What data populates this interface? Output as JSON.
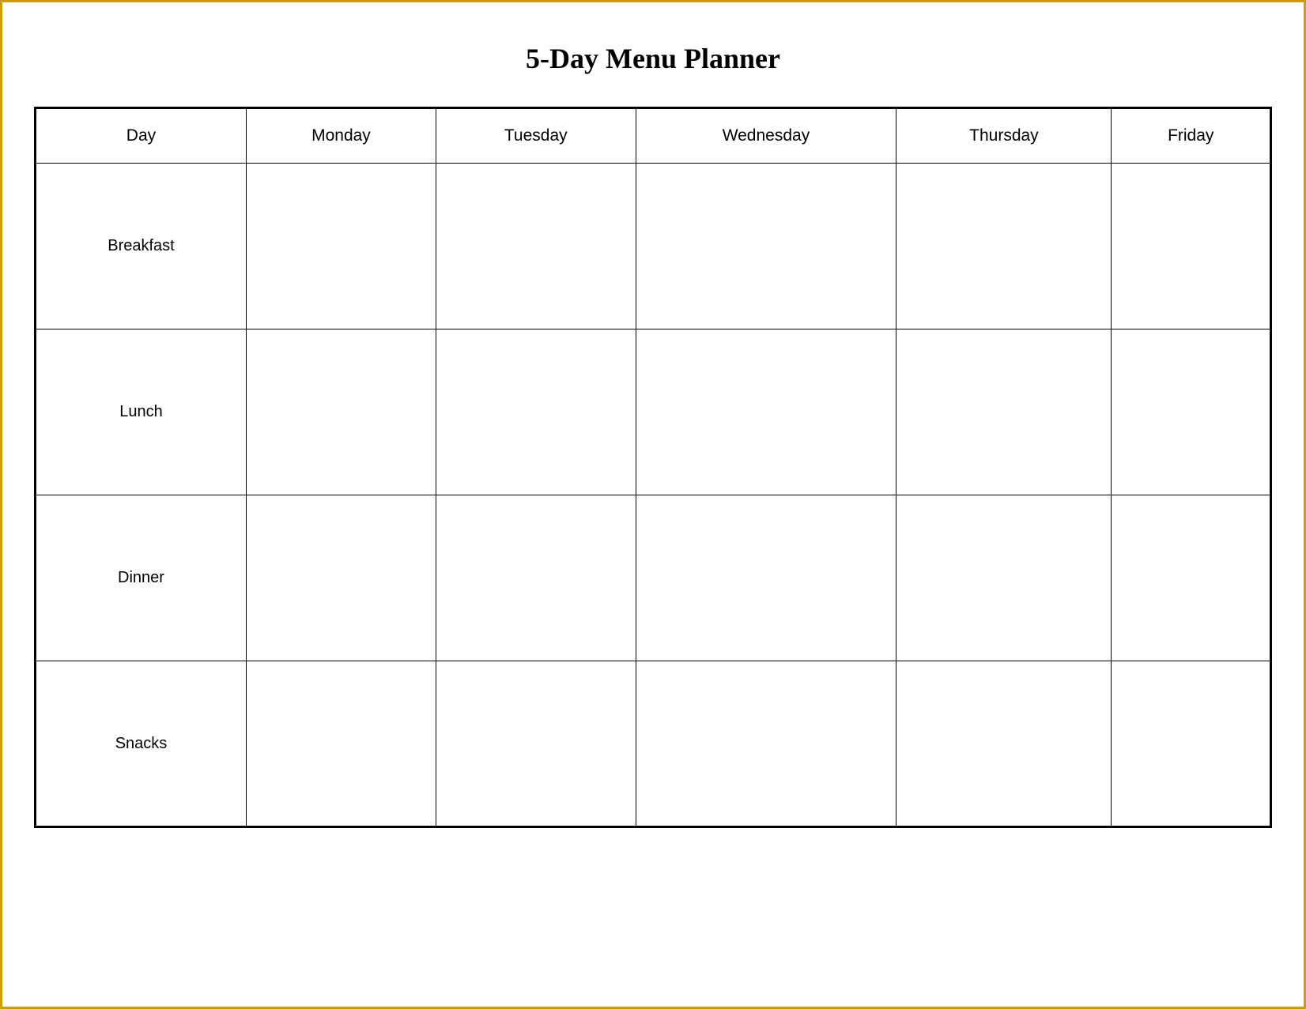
{
  "title": "5-Day Menu Planner",
  "columns": {
    "day": "Day",
    "monday": "Monday",
    "tuesday": "Tuesday",
    "wednesday": "Wednesday",
    "thursday": "Thursday",
    "friday": "Friday"
  },
  "rows": [
    {
      "label": "Breakfast"
    },
    {
      "label": "Lunch"
    },
    {
      "label": "Dinner"
    },
    {
      "label": "Snacks"
    }
  ]
}
